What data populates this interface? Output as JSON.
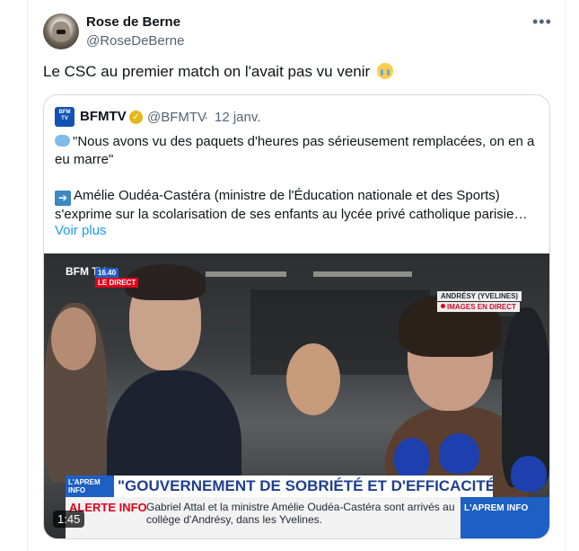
{
  "author": {
    "name": "Rose de Berne",
    "handle": "@RoseDeBerne",
    "avatar_icon": "avatar-photo",
    "more_icon": "more-dots-icon"
  },
  "tweet": {
    "text": "Le CSC au premier match on l'avait pas vu venir",
    "emoji": "crying-face-emoji"
  },
  "quoted": {
    "name": "BFMTV",
    "logo_text": "BFM TV",
    "verified": "gold-check-badge",
    "handle": "@BFMTV",
    "separator": "·",
    "date": "12 janv.",
    "line1_icon": "speech-balloon-emoji",
    "line1": "\"Nous avons vu des paquets d'heures pas sérieusement remplacées, on en a eu marre\"",
    "line2_icon": "right-arrow-emoji",
    "line2": "Amélie Oudéa-Castéra (ministre de l'Éducation nationale et des Sports) s'exprime sur la scolarisation de ses enfants au lycée privé catholique parisie…",
    "see_more": "Voir plus"
  },
  "video": {
    "duration": "1:45",
    "channel": "BFM TV.",
    "time": "16.40",
    "direct": "LE DIRECT",
    "location": "ANDRÉSY (YVELINES)",
    "live_label": "IMAGES EN DIRECT",
    "program": "L'APREM INFO",
    "headline": "\"GOUVERNEMENT DE SOBRIÉTÉ ET D'EFFICACITÉ\"",
    "alert_label": "ALERTE INFO",
    "alert_text": "Gabriel Attal et la ministre Amélie Oudéa-Castéra sont arrivés au collège d'Andrésy, dans les Yvelines.",
    "corner_program": "L'APREM INFO"
  },
  "colors": {
    "link": "#1d9bf0",
    "secondary": "#536471",
    "bfm_blue": "#1e5fc3",
    "alert_red": "#e2001a"
  }
}
